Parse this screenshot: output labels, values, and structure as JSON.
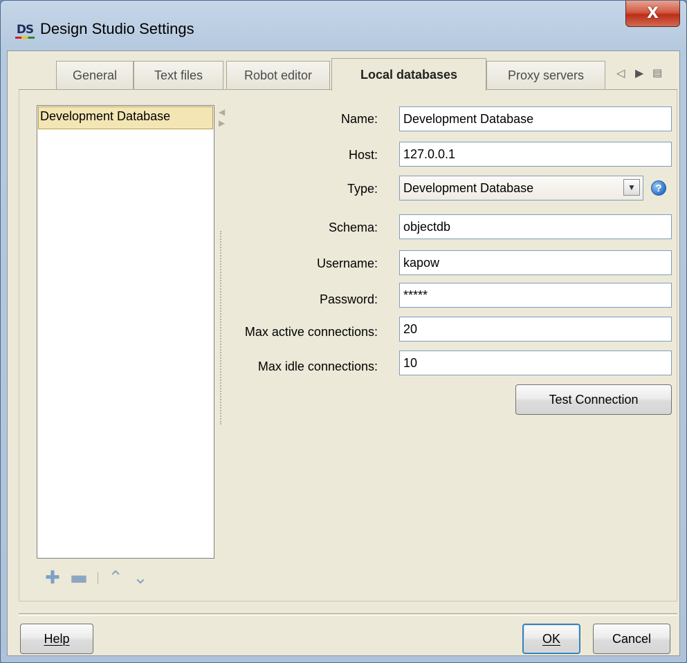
{
  "window": {
    "icon_text": "DS",
    "title": "Design Studio Settings",
    "close_glyph": "X"
  },
  "tabs": [
    {
      "label": "General",
      "active": false
    },
    {
      "label": "Text files",
      "active": false
    },
    {
      "label": "Robot editor",
      "active": false
    },
    {
      "label": "Local databases",
      "active": true
    },
    {
      "label": "Proxy servers",
      "active": false
    }
  ],
  "tab_nav": {
    "prev_icon": "scroll-left-icon",
    "next_icon": "scroll-right-icon",
    "menu_icon": "tab-list-icon"
  },
  "database_list": {
    "items": [
      "Development Database"
    ],
    "selected": "Development Database"
  },
  "form": {
    "name_label": "Name:",
    "name_value": "Development Database",
    "host_label": "Host:",
    "host_value": "127.0.0.1",
    "type_label": "Type:",
    "type_value": "Development Database",
    "schema_label": "Schema:",
    "schema_value": "objectdb",
    "username_label": "Username:",
    "username_value": "kapow",
    "password_label": "Password:",
    "password_value": "*****",
    "max_active_label": "Max active connections:",
    "max_active_value": "20",
    "max_idle_label": "Max idle connections:",
    "max_idle_value": "10",
    "test_button": "Test Connection"
  },
  "list_toolbar": {
    "add_icon": "plus-icon",
    "remove_icon": "minus-icon",
    "up_icon": "chevron-up-icon",
    "down_icon": "chevron-down-icon"
  },
  "footer": {
    "help_button": "Help",
    "ok_button": "OK",
    "cancel_button": "Cancel"
  }
}
